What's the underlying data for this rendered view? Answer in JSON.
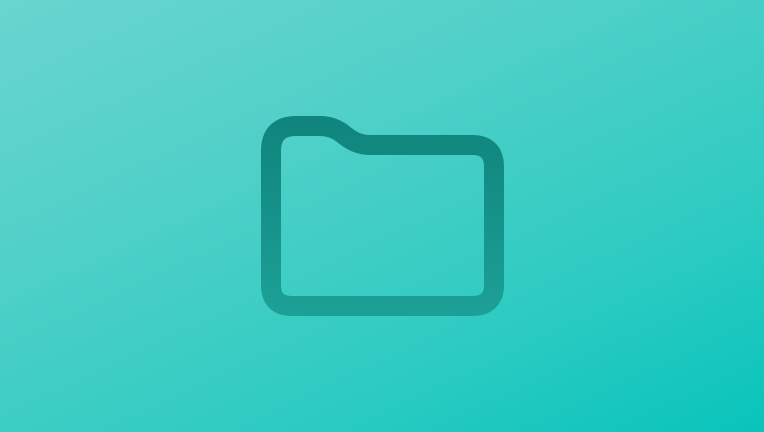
{
  "background": {
    "gradient_start": "#6ad5cf",
    "gradient_end": "#08c4bb"
  },
  "icon": {
    "name": "folder-icon",
    "stroke_color_top": "#0f857d",
    "stroke_color_bottom": "#1c9f96"
  }
}
